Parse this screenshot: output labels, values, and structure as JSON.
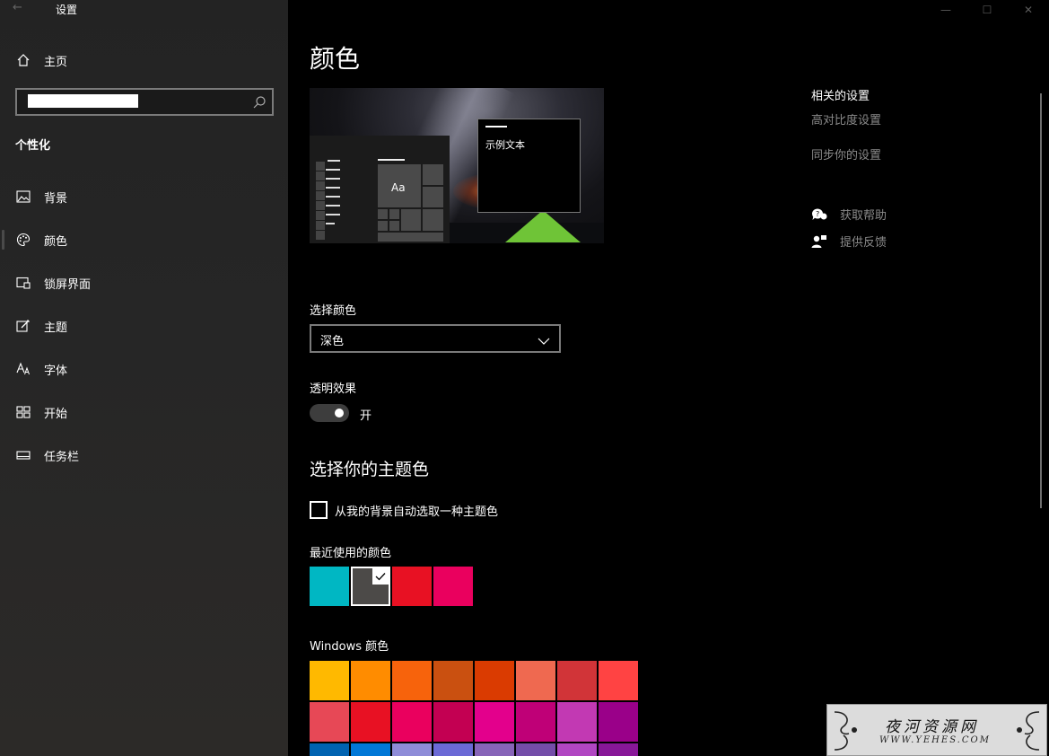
{
  "window": {
    "title": "设置",
    "back_glyph": "←",
    "minimize_glyph": "—",
    "maximize_glyph": "☐",
    "close_glyph": "✕"
  },
  "sidebar": {
    "home_label": "主页",
    "search": {
      "value": "",
      "placeholder": ""
    },
    "section_title": "个性化",
    "items": [
      {
        "label": "背景",
        "icon": "image-icon"
      },
      {
        "label": "颜色",
        "icon": "palette-icon",
        "selected": true
      },
      {
        "label": "锁屏界面",
        "icon": "lock-screen-icon"
      },
      {
        "label": "主题",
        "icon": "theme-brush-icon"
      },
      {
        "label": "字体",
        "icon": "font-icon"
      },
      {
        "label": "开始",
        "icon": "start-icon"
      },
      {
        "label": "任务栏",
        "icon": "taskbar-icon"
      }
    ]
  },
  "main": {
    "title": "颜色",
    "preview": {
      "tile_text": "Aa",
      "sample_text": "示例文本"
    },
    "choose_color": {
      "label": "选择颜色",
      "value": "深色"
    },
    "transparency": {
      "label": "透明效果",
      "state": "开",
      "on": true
    },
    "accent_heading": "选择你的主题色",
    "auto_pick_label": "从我的背景自动选取一种主题色",
    "auto_pick_checked": false,
    "recent": {
      "label": "最近使用的颜色",
      "colors": [
        "#00B7C3",
        "#4C4A48",
        "#E81123",
        "#EA005E"
      ],
      "selected_index": 1
    },
    "windows_colors": {
      "label": "Windows 颜色",
      "rows": [
        [
          "#FFB900",
          "#FF8C00",
          "#F7630C",
          "#CA5010",
          "#DA3B01",
          "#EF6950",
          "#D13438",
          "#FF4343"
        ],
        [
          "#E74856",
          "#E81123",
          "#EA005E",
          "#C30052",
          "#E3008C",
          "#BF0077",
          "#C239B3",
          "#9A0089"
        ],
        [
          "#0063B1",
          "#0078D7",
          "#8E8CD8",
          "#6B69D6",
          "#8764B8",
          "#744DA9",
          "#B146C2",
          "#881798"
        ]
      ]
    }
  },
  "related": {
    "title": "相关的设置",
    "links": [
      "高对比度设置",
      "同步你的设置"
    ],
    "help": [
      {
        "label": "获取帮助",
        "icon": "help-chat-icon"
      },
      {
        "label": "提供反馈",
        "icon": "feedback-icon"
      }
    ]
  },
  "watermark": {
    "line1": "夜河资源网",
    "line2": "WWW.YEHES.COM"
  }
}
